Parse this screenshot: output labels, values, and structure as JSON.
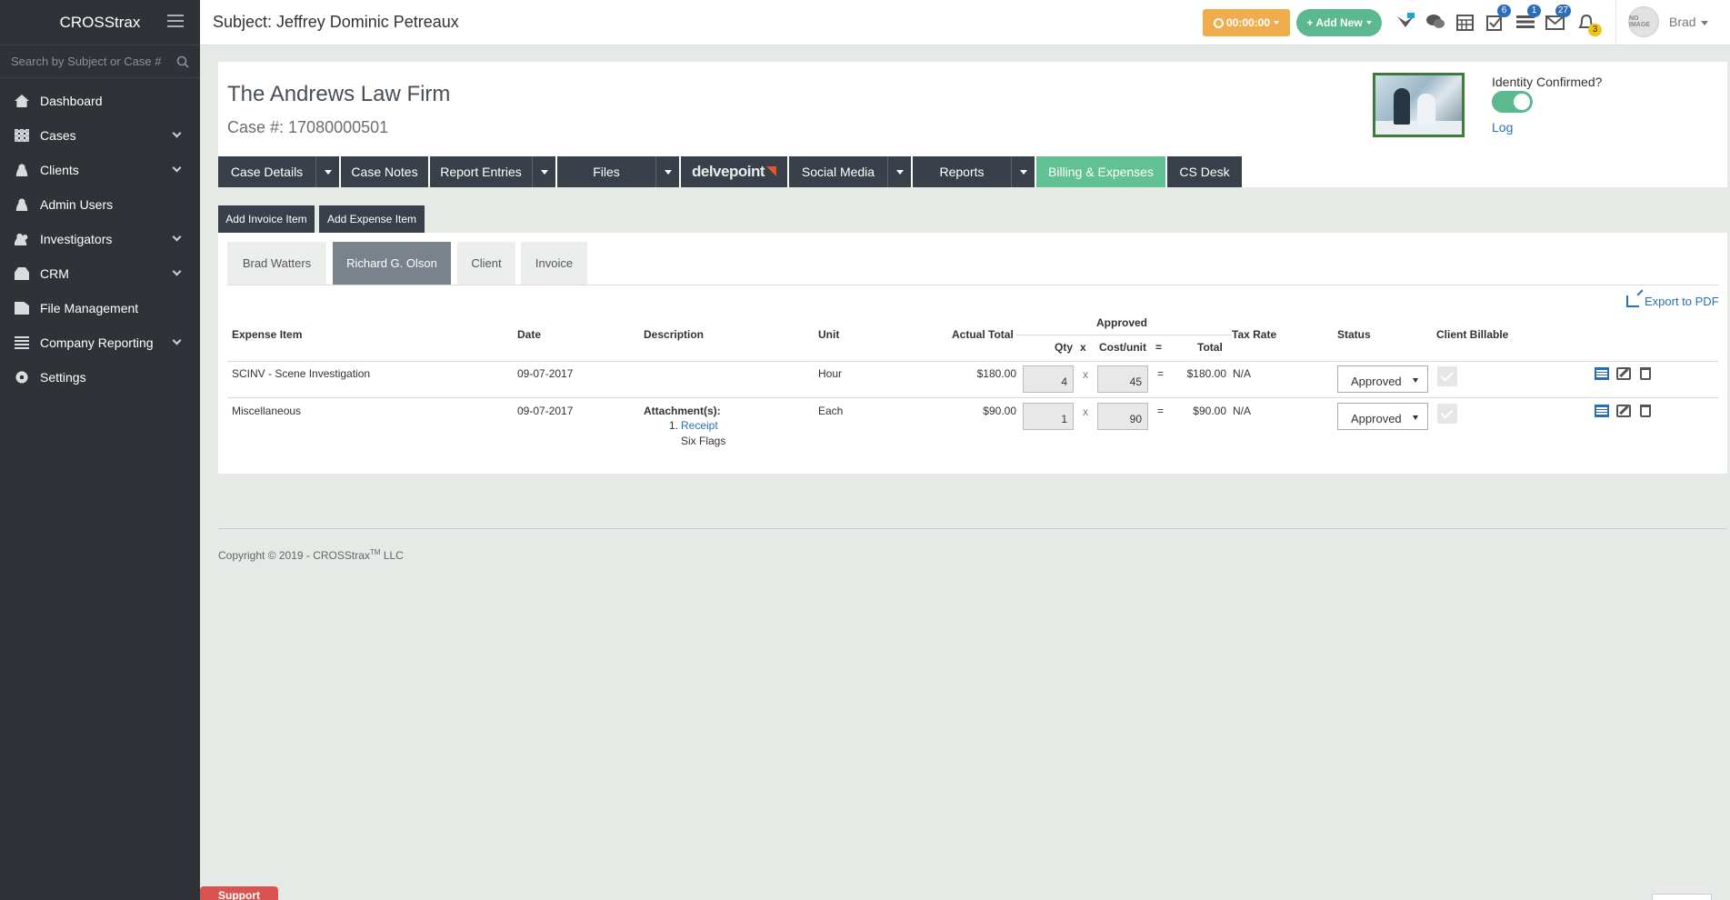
{
  "app": {
    "brand": "CROSStrax",
    "search_placeholder": "Search by Subject or Case #"
  },
  "sidebar": {
    "items": [
      {
        "label": "Dashboard",
        "icon": "home-icon",
        "has_children": false
      },
      {
        "label": "Cases",
        "icon": "grid-icon",
        "has_children": true
      },
      {
        "label": "Clients",
        "icon": "user-icon",
        "has_children": true
      },
      {
        "label": "Admin Users",
        "icon": "user-icon",
        "has_children": false
      },
      {
        "label": "Investigators",
        "icon": "users-icon",
        "has_children": true
      },
      {
        "label": "CRM",
        "icon": "cubes-icon",
        "has_children": true
      },
      {
        "label": "File Management",
        "icon": "file-icon",
        "has_children": false
      },
      {
        "label": "Company Reporting",
        "icon": "list-icon",
        "has_children": true
      },
      {
        "label": "Settings",
        "icon": "gear-icon",
        "has_children": false
      }
    ]
  },
  "topbar": {
    "title": "Subject: Jeffrey Dominic Petreaux",
    "timer": "00:00:00",
    "add_new": "Add New",
    "badges": {
      "tasks": "6",
      "list": "1",
      "mail": "27",
      "alerts": "3"
    },
    "avatar_text": "NO IMAGE",
    "user": "Brad"
  },
  "case": {
    "firm": "The Andrews Law Firm",
    "case_no": "Case #: 17080000501",
    "identity_label": "Identity Confirmed?",
    "identity_confirmed": true,
    "log_link": "Log"
  },
  "tabs": [
    {
      "label": "Case Details",
      "dropdown": true
    },
    {
      "label": "Case Notes",
      "dropdown": false
    },
    {
      "label": "Report Entries",
      "dropdown": true
    },
    {
      "label": "Files",
      "dropdown": true
    },
    {
      "label": "delvepoint",
      "dropdown": false
    },
    {
      "label": "Social Media",
      "dropdown": true
    },
    {
      "label": "Reports",
      "dropdown": true
    },
    {
      "label": "Billing & Expenses",
      "dropdown": false,
      "active": true
    },
    {
      "label": "CS Desk",
      "dropdown": false
    }
  ],
  "actions": {
    "add_invoice": "Add Invoice Item",
    "add_expense": "Add Expense Item"
  },
  "panel_tabs": [
    {
      "label": "Brad Watters"
    },
    {
      "label": "Richard G. Olson",
      "active": true
    },
    {
      "label": "Client"
    },
    {
      "label": "Invoice"
    }
  ],
  "export_label": "Export to PDF",
  "table": {
    "headers": {
      "item": "Expense Item",
      "date": "Date",
      "description": "Description",
      "unit": "Unit",
      "actual_total": "Actual Total",
      "approved": "Approved",
      "qty": "Qty",
      "x": "x",
      "cost_unit": "Cost/unit",
      "eq": "=",
      "total": "Total",
      "tax_rate": "Tax Rate",
      "status": "Status",
      "client_billable": "Client Billable"
    },
    "rows": [
      {
        "item": "SCINV - Scene Investigation",
        "date": "09-07-2017",
        "description": "",
        "unit": "Hour",
        "actual_total": "$180.00",
        "qty": "4",
        "x": "x",
        "cost": "45",
        "eq": "=",
        "total": "$180.00",
        "tax": "N/A",
        "status": "Approved"
      },
      {
        "item": "Miscellaneous",
        "date": "09-07-2017",
        "attach_label": "Attachment(s):",
        "attach_num": "1.",
        "attach_link": "Receipt",
        "attach_note": "Six Flags",
        "unit": "Each",
        "actual_total": "$90.00",
        "qty": "1",
        "x": "x",
        "cost": "90",
        "eq": "=",
        "total": "$90.00",
        "tax": "N/A",
        "status": "Approved"
      }
    ]
  },
  "footer": {
    "copy_prefix": "Copyright © 2019 - CROSStrax",
    "tm": "TM",
    "copy_suffix": "LLC",
    "support": "Support"
  }
}
